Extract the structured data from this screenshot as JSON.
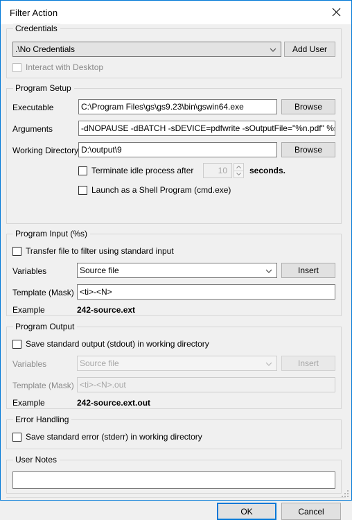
{
  "window": {
    "title": "Filter Action",
    "close_icon": "close-icon",
    "accent_color": "#0078d7",
    "body_color": "#f0f0f0",
    "titlebar_color": "#ffffff"
  },
  "credentials": {
    "legend": "Credentials",
    "combo_value": ".\\No Credentials",
    "add_user_label": "Add User",
    "interact_checkbox": {
      "label": "Interact with Desktop",
      "checked": false,
      "enabled": false
    }
  },
  "program_setup": {
    "legend": "Program Setup",
    "executable_label": "Executable",
    "executable_value": "C:\\Program Files\\gs\\gs9.23\\bin\\gswin64.exe",
    "executable_browse_label": "Browse",
    "arguments_label": "Arguments",
    "arguments_value": "-dNOPAUSE -dBATCH -sDEVICE=pdfwrite -sOutputFile=\"%n.pdf\" %s",
    "working_dir_label": "Working Directory",
    "working_dir_value": "D:\\output\\9",
    "working_dir_browse_label": "Browse",
    "terminate_checkbox": {
      "label": "Terminate idle process after",
      "checked": false,
      "enabled": true
    },
    "terminate_seconds_value": "10",
    "terminate_suffix": "seconds.",
    "shell_checkbox": {
      "label": "Launch as a Shell Program (cmd.exe)",
      "checked": false,
      "enabled": true
    }
  },
  "program_input": {
    "legend": "Program Input (%s)",
    "transfer_checkbox": {
      "label": "Transfer file to filter using standard input",
      "checked": false,
      "enabled": true
    },
    "variables_label": "Variables",
    "variables_value": "Source file",
    "insert_label": "Insert",
    "template_label": "Template (Mask)",
    "template_value": "<ti>-<N>",
    "example_label": "Example",
    "example_value": "242-source.ext"
  },
  "program_output": {
    "legend": "Program Output",
    "save_stdout_checkbox": {
      "label": "Save standard output (stdout) in working directory",
      "checked": false,
      "enabled": true
    },
    "variables_label": "Variables",
    "variables_value": "Source file",
    "insert_label": "Insert",
    "template_label": "Template (Mask)",
    "template_value": "<ti>-<N>.out",
    "example_label": "Example",
    "example_value": "242-source.ext.out"
  },
  "error_handling": {
    "legend": "Error Handling",
    "save_stderr_checkbox": {
      "label": "Save standard error (stderr) in working directory",
      "checked": false,
      "enabled": true
    }
  },
  "user_notes": {
    "legend": "User Notes",
    "value": "",
    "placeholder": ""
  },
  "footer": {
    "ok_label": "OK",
    "cancel_label": "Cancel"
  }
}
